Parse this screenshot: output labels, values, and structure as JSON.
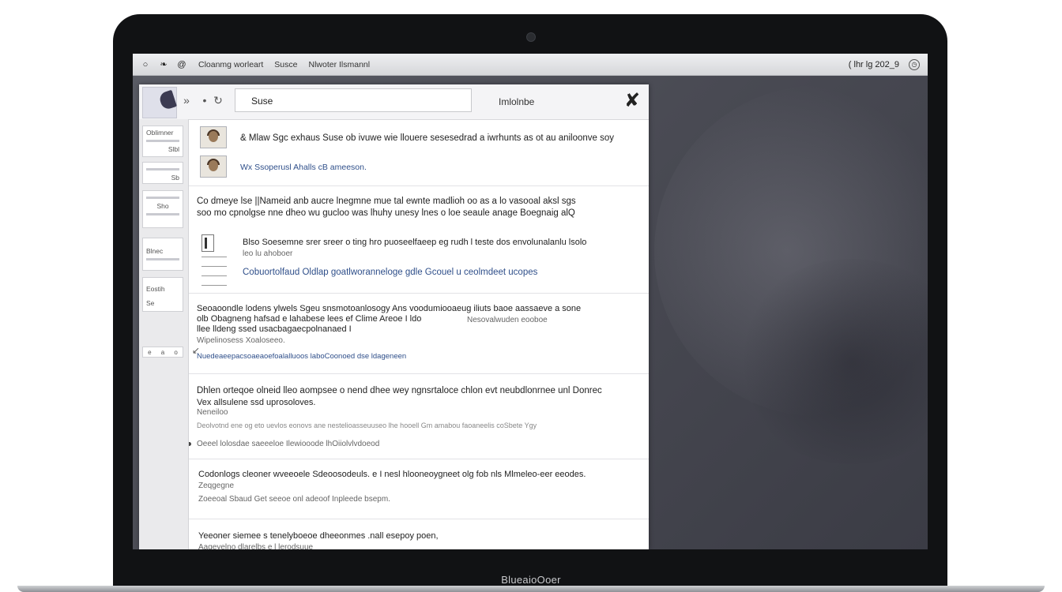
{
  "laptop": {
    "brand_label": "BlueaioOoer"
  },
  "menubar": {
    "apple_icon": "apple-icon",
    "items": [
      "Cloanmg worleart",
      "Susce",
      "Nlwoter Ilsmannl"
    ],
    "clock": "( lhr lg 202_9",
    "status_icon": "clock-icon"
  },
  "toolbar": {
    "forward_glyph": "»",
    "dot_glyph": "•",
    "refresh_glyph": "↻",
    "search_value": "Suse",
    "right_label": "Imlolnbe",
    "close_glyph": "✘"
  },
  "sidebar": {
    "cards": [
      {
        "label": "Oblimner",
        "sub": "Slbl"
      },
      {
        "label": "Sb",
        "sub": ""
      },
      {
        "label": "Sho",
        "sub": ""
      },
      {
        "label": "Blnec",
        "sub": ""
      },
      {
        "label": "Eostih",
        "sub": "Se"
      }
    ],
    "pill_labels": [
      "e",
      "a",
      "o"
    ]
  },
  "messages": [
    {
      "line1": "& Mlaw Sgc exhaus  Suse ob ivuwe wie llouere  sesesedrad a iwrhunts as ot au aniloonve soy",
      "line2": "Wx Ssoperusl Ahalls cB ameeson."
    },
    {
      "line1": "Co dmeye lse  ||Nameid anb aucre lnegmne mue tal ewnte madlioh oo as a lo vasooal aksl sgs",
      "line2": "soo mo cpnolgse nne dheo wu gucloo was lhuhy unesy lnes o loe seaule anage Boegnaig alQ",
      "line3": "Blso Soesemne srer sreer o ting hro puoseelfaeep eg rudh l teste dos envolunalanlu lsolo",
      "line4": "leo lu ahoboer",
      "link": "Cobuortolfaud Oldlap goatlworanneloge gdle Gcouel u ceolmdeet ucopes"
    },
    {
      "line1": "Seoaoondle lodens ylwels Sgeu snsmotoanlosogy Ans voodumiooaeug iliuts baoe aassaeve a sone",
      "line2": "olb Obagneng hafsad e lahabese lees ef Clime Areoe I ldo",
      "line2b": "Nesovalwuden eooboe",
      "line3": "llee lldeng ssed usacbagaecpolnanaed I",
      "line4": "Wipelinosess Xoaloseeo.",
      "link": "Nuedeaeepacsoaeaoefoalalluoos laboCoonoed dse ldageneen"
    },
    {
      "line1": "Dhlen orteqoe olneid lleo aompsee o nend dhee wey ngnsrtaloce chlon evt neubdlonrnee unl Donrec",
      "line2": "Vex allsulene ssd uprosoloves.",
      "line3": "Neneiloo",
      "line4": "Deolvotnd ene og eto uevlos eonovs ane nestelioasseuuseo lhe hooell Gm amabou faoaneelis coSbete Ygy",
      "link": "Oeeel lolosdae saeeeloe Ilewiooode lhOiiolvlvdoeod"
    },
    {
      "line1": "Codonlogs cleoner wveeoele Sdeoosodeuls. e  I nesl hlooneoygneet olg fob nls Mlmeleo-eer eeodes.",
      "line2": "Zeqgegne",
      "line3": "Zoeeoal Sbaud Get seeoe onl adeoof Inpleede bsepm.",
      "link": ""
    },
    {
      "line1": "Yeeoner siemee s tenelyboeoe dheeonmes .nall esepoy poen,",
      "line2": "Aageyelno dlarelbs e l lerodsuue",
      "line3": "",
      "link": ""
    }
  ]
}
